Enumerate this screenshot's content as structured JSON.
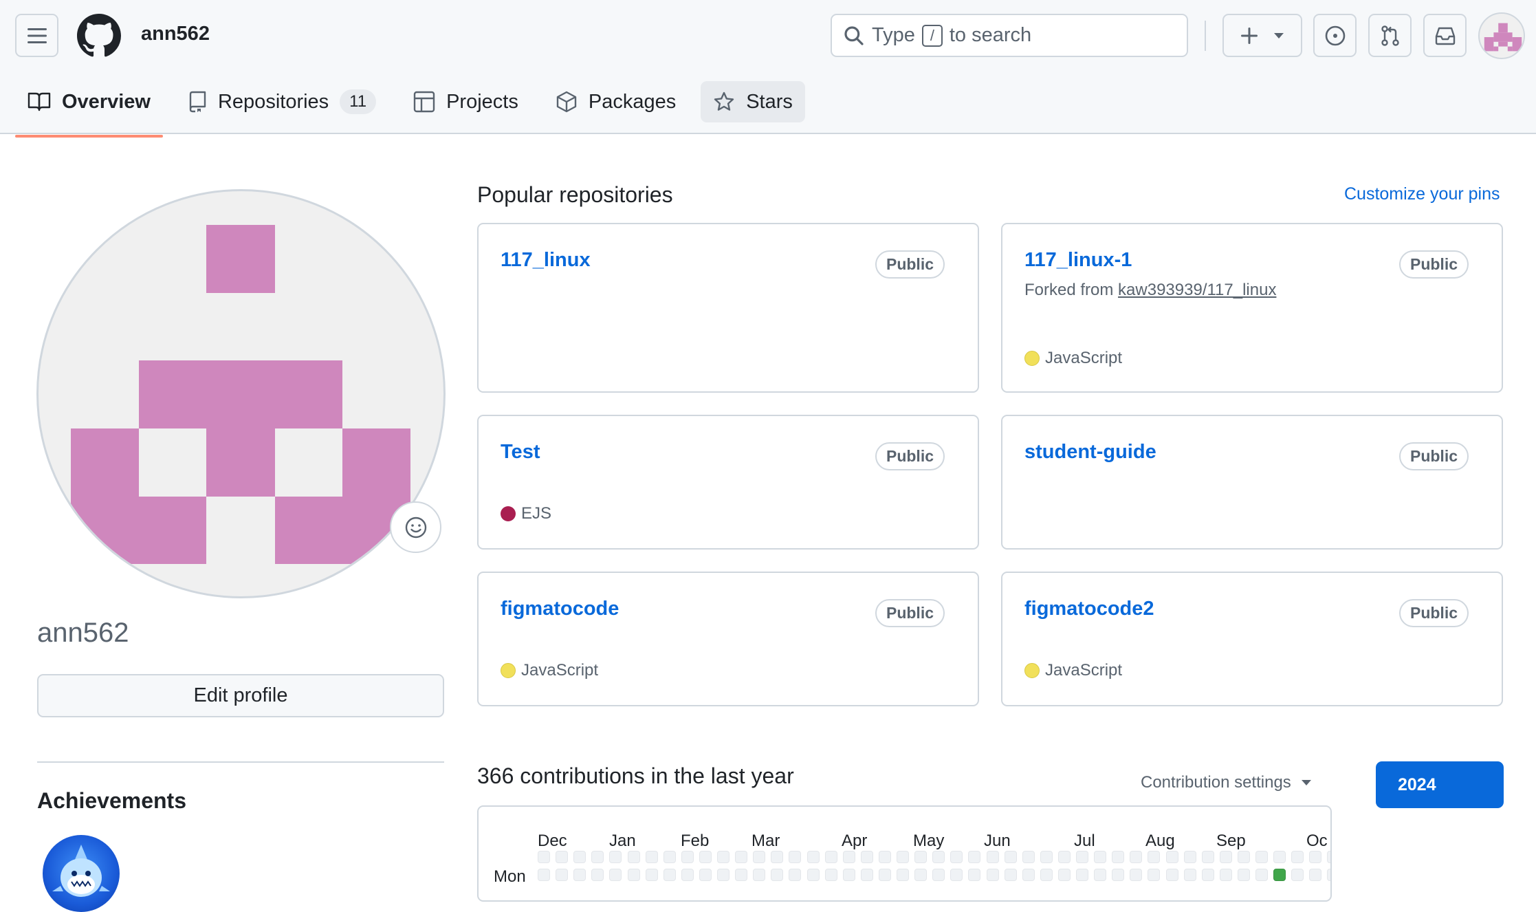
{
  "header": {
    "username": "ann562",
    "search": {
      "text_before": "Type",
      "key": "/",
      "text_after": "to search"
    },
    "icons": [
      "hamburger-icon",
      "github-logo-icon",
      "search-icon",
      "plus-icon",
      "triangle-down-icon",
      "issue-opened-icon",
      "git-pull-request-icon",
      "inbox-icon",
      "avatar"
    ]
  },
  "tabs": [
    {
      "label": "Overview",
      "icon": "book-icon",
      "active": true
    },
    {
      "label": "Repositories",
      "icon": "repo-icon",
      "count": "11"
    },
    {
      "label": "Projects",
      "icon": "table-icon"
    },
    {
      "label": "Packages",
      "icon": "package-icon"
    },
    {
      "label": "Stars",
      "icon": "star-icon"
    }
  ],
  "profile": {
    "name": "ann562",
    "edit_label": "Edit profile",
    "achievements_title": "Achievements"
  },
  "popular": {
    "title": "Popular repositories",
    "customize_label": "Customize your pins",
    "repos": [
      {
        "name": "117_linux",
        "visibility": "Public"
      },
      {
        "name": "117_linux-1",
        "visibility": "Public",
        "fork_prefix": "Forked from",
        "fork_source": "kaw393939/117_linux",
        "language": "JavaScript",
        "language_color": "#f1e05a"
      },
      {
        "name": "Test",
        "visibility": "Public",
        "language": "EJS",
        "language_color": "#a91e50"
      },
      {
        "name": "student-guide",
        "visibility": "Public"
      },
      {
        "name": "figmatocode",
        "visibility": "Public",
        "language": "JavaScript",
        "language_color": "#f1e05a"
      },
      {
        "name": "figmatocode2",
        "visibility": "Public",
        "language": "JavaScript",
        "language_color": "#f1e05a"
      }
    ]
  },
  "contributions": {
    "title": "366 contributions in the last year",
    "settings_label": "Contribution settings",
    "year": "2024",
    "months": [
      "Dec",
      "Jan",
      "Feb",
      "Mar",
      "Apr",
      "May",
      "Jun",
      "Jul",
      "Aug",
      "Sep",
      "Oc"
    ],
    "day_label": "Mon"
  },
  "colors": {
    "accent": "#0969da",
    "tab_underline": "#fd8c73",
    "identicon": "#cf87bd",
    "contribution_green": "#40a64a"
  }
}
